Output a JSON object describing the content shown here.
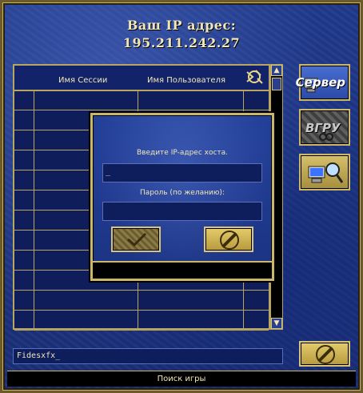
{
  "header": {
    "ip_label": "Ваш IP адрес:",
    "ip_value": "195.211.242.27"
  },
  "session_list": {
    "columns": [
      "Имя Сессии",
      "Имя Пользователя"
    ],
    "rows": []
  },
  "side_buttons": {
    "server_label": "Сервер",
    "join_label": "ВГРУ"
  },
  "dialog": {
    "host_label": "Введите IP-адрес хоста.",
    "host_value": "_",
    "password_label": "Пароль (по желанию):",
    "password_value": ""
  },
  "player_name": "Fidesxfx_",
  "status_text": "Поиск игры",
  "colors": {
    "gold": "#cbb66a",
    "panel_blue": "#1c3480",
    "text": "#f1e6b8"
  }
}
